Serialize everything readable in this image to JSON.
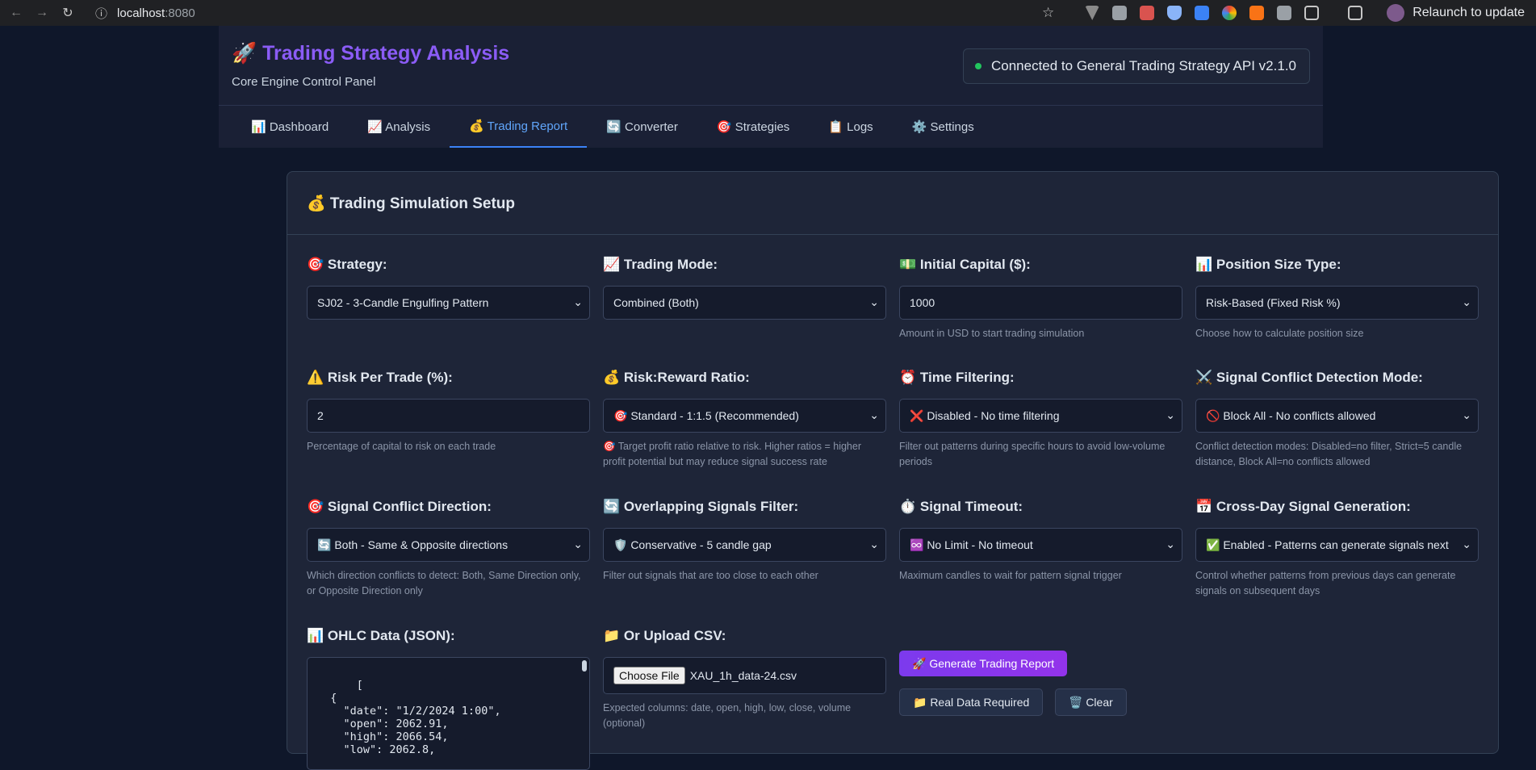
{
  "browser": {
    "url_host": "localhost",
    "url_port": ":8080",
    "relaunch_label": "Relaunch to update",
    "back_icon": "←",
    "forward_icon": "→",
    "reload_icon": "↻",
    "info_icon": "ⓘ",
    "star_icon": "☆"
  },
  "header": {
    "title": "🚀 Trading Strategy Analysis",
    "subtitle": "Core Engine Control Panel",
    "connection_status": "Connected to General Trading Strategy API v2.1.0",
    "status_color": "#22c55e",
    "accent_color": "#8b5cf6"
  },
  "tabs": [
    {
      "label": "📊 Dashboard"
    },
    {
      "label": "📈 Analysis"
    },
    {
      "label": "💰 Trading Report"
    },
    {
      "label": "🔄 Converter"
    },
    {
      "label": "🎯 Strategies"
    },
    {
      "label": "📋 Logs"
    },
    {
      "label": "⚙️ Settings"
    }
  ],
  "active_tab": "💰 Trading Report",
  "setup": {
    "title": "💰 Trading Simulation Setup",
    "strategy": {
      "label": "🎯 Strategy:",
      "value": "SJ02 - 3-Candle Engulfing Pattern"
    },
    "trading_mode": {
      "label": "📈 Trading Mode:",
      "value": "Combined (Both)"
    },
    "initial_capital": {
      "label": "💵 Initial Capital ($):",
      "value": "1000",
      "help": "Amount in USD to start trading simulation"
    },
    "position_size": {
      "label": "📊 Position Size Type:",
      "value": "Risk-Based (Fixed Risk %)",
      "help": "Choose how to calculate position size"
    },
    "risk_per_trade": {
      "label": "⚠️ Risk Per Trade (%):",
      "value": "2",
      "help": "Percentage of capital to risk on each trade"
    },
    "risk_reward": {
      "label": "💰 Risk:Reward Ratio:",
      "value": "🎯 Standard - 1:1.5 (Recommended)",
      "help": "🎯 Target profit ratio relative to risk. Higher ratios = higher profit potential but may reduce signal success rate"
    },
    "time_filtering": {
      "label": "⏰ Time Filtering:",
      "value": "❌ Disabled - No time filtering",
      "help": "Filter out patterns during specific hours to avoid low-volume periods"
    },
    "conflict_mode": {
      "label": "⚔️ Signal Conflict Detection Mode:",
      "value": "🚫 Block All - No conflicts allowed",
      "help": "Conflict detection modes: Disabled=no filter, Strict=5 candle distance, Block All=no conflicts allowed"
    },
    "conflict_direction": {
      "label": "🎯 Signal Conflict Direction:",
      "value": "🔄 Both - Same & Opposite directions",
      "help": "Which direction conflicts to detect: Both, Same Direction only, or Opposite Direction only"
    },
    "overlap_filter": {
      "label": "🔄 Overlapping Signals Filter:",
      "value": "🛡️ Conservative - 5 candle gap",
      "help": "Filter out signals that are too close to each other"
    },
    "signal_timeout": {
      "label": "⏱️ Signal Timeout:",
      "value": "♾️ No Limit - No timeout",
      "help": "Maximum candles to wait for pattern signal trigger"
    },
    "cross_day": {
      "label": "📅 Cross-Day Signal Generation:",
      "value": "✅ Enabled - Patterns can generate signals next",
      "help": "Control whether patterns from previous days can generate signals on subsequent days"
    },
    "ohlc": {
      "label": "📊 OHLC Data (JSON):",
      "value": "[\n  {\n    \"date\": \"1/2/2024 1:00\",\n    \"open\": 2062.91,\n    \"high\": 2066.54,\n    \"low\": 2062.8,"
    },
    "csv": {
      "label": "📁 Or Upload CSV:",
      "choose_label": "Choose File",
      "file_name": "XAU_1h_data-24.csv",
      "help": "Expected columns: date, open, high, low, close, volume (optional)"
    },
    "generate_label": "🚀 Generate Trading Report",
    "real_data_label": "📁 Real Data Required",
    "clear_label": "🗑️ Clear"
  }
}
